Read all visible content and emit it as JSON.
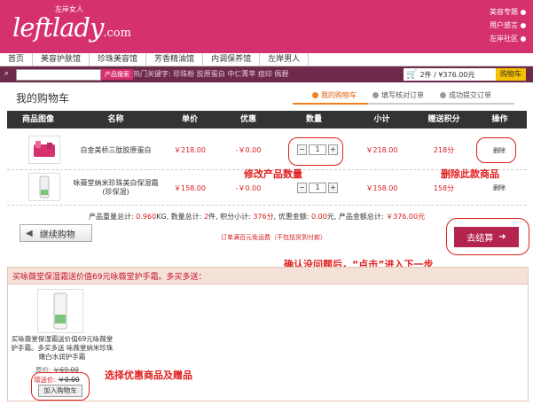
{
  "header": {
    "logo": "leftlady",
    "logo_suffix": ".com",
    "logo_tag": "左岸女人",
    "top_links": [
      "美容专题",
      "用户感言",
      "左岸社区"
    ]
  },
  "nav": [
    "首页",
    "美容护肤馆",
    "珍珠美容馆",
    "芳香精油馆",
    "内调保养馆",
    "左岸男人"
  ],
  "search": {
    "placeholder": "",
    "button_label": "产品搜索",
    "hot_keywords": "热门关键字: 珍珠粉  胶原蛋白  中仁菁萃  痘印  佩碧"
  },
  "mini_cart": {
    "summary": "2件 / ¥376.00元",
    "button_label": "购物车"
  },
  "page_title": "我的购物车",
  "steps": [
    "我的购物车",
    "填写核对订单",
    "成功提交订单"
  ],
  "table": {
    "headers": [
      "商品图像",
      "名称",
      "单价",
      "优惠",
      "数量",
      "小计",
      "赠送积分",
      "操作"
    ],
    "rows": [
      {
        "name": "白金美桥三肽胶原蛋白",
        "price": "￥218.00",
        "discount": "-￥0.00",
        "qty": "1",
        "subtotal": "￥218.00",
        "points": "218分",
        "action": "删除"
      },
      {
        "name": "咏薇堂纳米珍珠美白保湿霜(珍保湿)",
        "price": "￥158.00",
        "discount": "-￥0.00",
        "qty": "1",
        "subtotal": "￥158.00",
        "points": "158分",
        "action": "删除"
      }
    ]
  },
  "totals": {
    "w_label": "产品重量总计:",
    "weight": "0.960",
    "w_unit": "KG, 数量总计:",
    "count": "2",
    "c_unit": "件, 积分小计:",
    "points": "376分",
    "d_label": ", 优惠金额:",
    "discount": "0.00",
    "a_label": "元, 产品金额总计:",
    "amount": "￥376.00元",
    "free_shipping": "订单满百元免运费（不包括货到付款）"
  },
  "buttons": {
    "continue": "继续购物",
    "checkout": "去结算"
  },
  "annotations": {
    "qty": "修改产品数量",
    "delete": "删除此款商品",
    "confirm": "确认没问题后，“点击”进入下一步",
    "promo": "选择优惠商品及赠品"
  },
  "promo": {
    "title": "买咏薇堂保湿霜送价值69元咏薇堂护手霜。多买多送：",
    "item_name": "买咏薇堂保湿霜送价值69元咏薇堂护手霜。多买多送 咏薇堂纳米珍珠嫩白水润护手霜",
    "orig_label": "原价:",
    "orig_price": "￥69.00",
    "gift_label": "增送价:",
    "gift_price": "￥0.00",
    "add_button": "加入购物车"
  },
  "colors": {
    "brand": "#d6316f",
    "search_bar": "#6e2a4a",
    "table_header": "#333333",
    "price_red": "#d61e1e",
    "annotation_red": "#e02020",
    "checkout": "#b3254f",
    "step_active": "#f08020"
  }
}
